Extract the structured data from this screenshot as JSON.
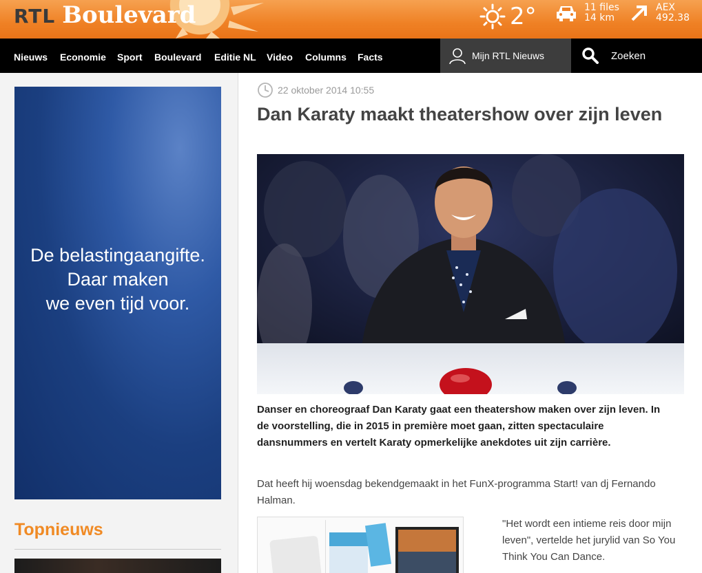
{
  "header": {
    "logo_rtl": "RTL",
    "logo_name": "Boulevard",
    "weather_temp": "2°",
    "traffic_files": "11 files",
    "traffic_km": "14 km",
    "aex_label": "AEX",
    "aex_value": "492.38"
  },
  "nav": {
    "items": [
      "Nieuws",
      "Economie",
      "Sport",
      "Boulevard",
      "Editie NL",
      "Video",
      "Columns",
      "Facts"
    ],
    "account_label": "Mijn RTL Nieuws",
    "search_label": "Zoeken"
  },
  "sidebar": {
    "ad_line1": "De belastingaangifte.",
    "ad_line2": "Daar maken",
    "ad_line3": "we even tijd voor.",
    "section_title": "Topnieuws"
  },
  "article": {
    "date": "22 oktober 2014 10:55",
    "title": "Dan Karaty maakt theatershow over zijn leven",
    "lead": "Danser en choreograaf Dan Karaty gaat een theatershow maken over zijn leven. In de voorstelling, die in 2015 in première moet gaan, zitten spectaculaire dansnummers en vertelt Karaty opmerkelijke anekdotes uit zijn carrière.",
    "body": "Dat heeft hij woensdag bekendgemaakt in het FunX-programma Start! van dj Fernando Halman.",
    "quote": "\"Het wordt een intieme reis door mijn leven\", vertelde het jurylid van So You Think You Can Dance."
  },
  "colors": {
    "brand_orange": "#ef8125",
    "nav_bg": "#000000",
    "account_bg": "#3d3d3d",
    "section_orange": "#f08a24",
    "ad_blue": "#1b3f80"
  }
}
